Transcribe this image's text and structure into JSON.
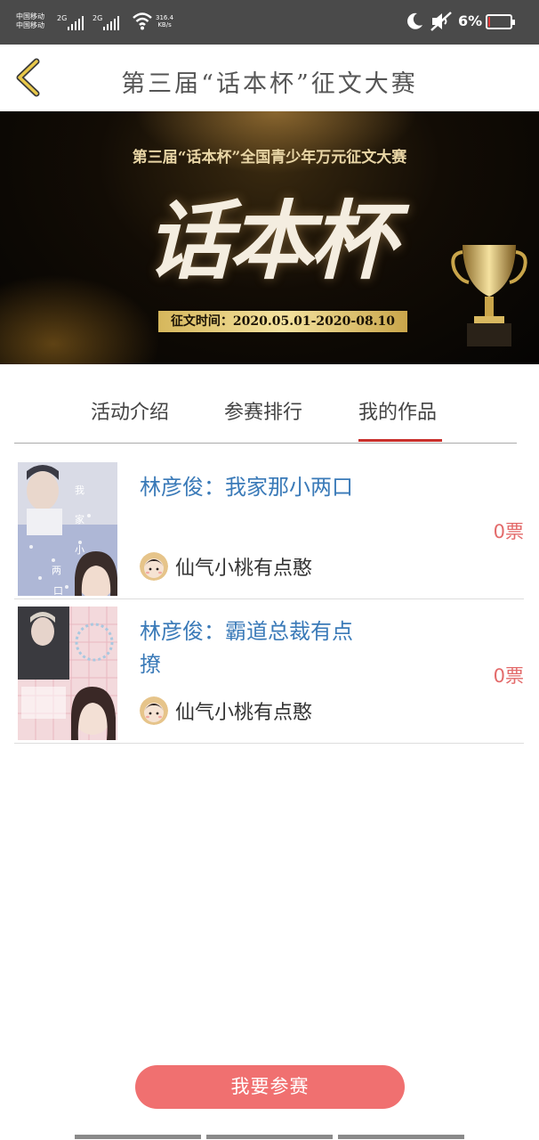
{
  "status_bar": {
    "carrier_1": "中国移动",
    "carrier_2": "中国移动",
    "sig1_label": "2G",
    "sig2_label": "2G",
    "net_speed_value": "316.4",
    "net_speed_unit": "KB/s",
    "battery_pct": "6%",
    "battery_level": 0.06,
    "battery_color": "#e23b3b"
  },
  "header": {
    "title": "第三届“话本杯”征文大赛"
  },
  "banner": {
    "subtitle": "第三届“话本杯”全国青少年万元征文大赛",
    "big_text": "话本杯",
    "date_text": "征文时间：2020.05.01-2020-08.10"
  },
  "tabs": [
    {
      "label": "活动介绍"
    },
    {
      "label": "参赛排行"
    },
    {
      "label": "我的作品",
      "active": true
    }
  ],
  "works": [
    {
      "title": "林彦俊：我家那小两口",
      "author": "仙气小桃有点憨",
      "votes": "0票"
    },
    {
      "title": "林彦俊：霸道总裁有点撩",
      "author": "仙气小桃有点憨",
      "votes": "0票"
    }
  ],
  "join_button": "我要参赛",
  "colors": {
    "accent_red": "#c9302c",
    "title_blue": "#3a7ab8",
    "votes_red": "#e36a6a",
    "button_red": "#f07070"
  }
}
